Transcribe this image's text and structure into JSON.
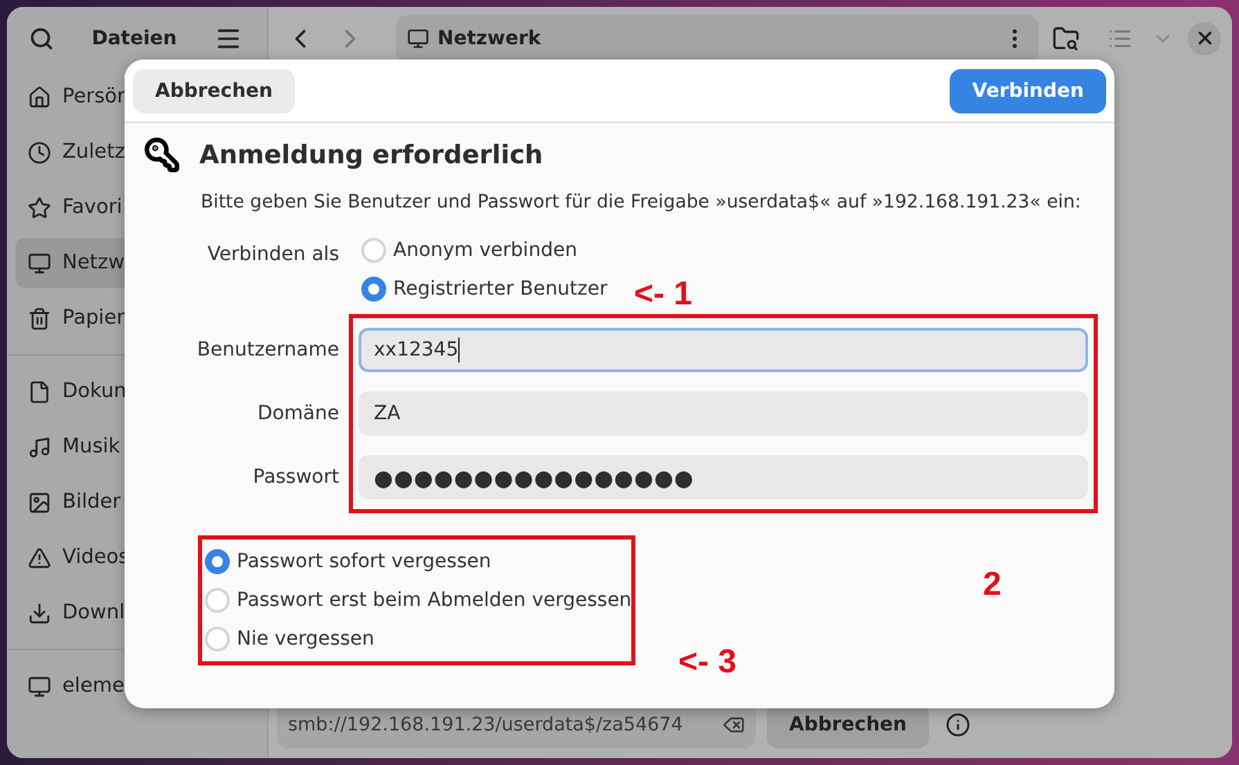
{
  "window": {
    "sidebar_title": "Dateien",
    "sidebar_groups": [
      [
        {
          "label": "Persön",
          "selected": false
        },
        {
          "label": "Zuletz",
          "selected": false
        },
        {
          "label": "Favori",
          "selected": false
        },
        {
          "label": "Netzw",
          "selected": true
        },
        {
          "label": "Papier",
          "selected": false
        }
      ],
      [
        {
          "label": "Dokun",
          "selected": false
        },
        {
          "label": "Musik",
          "selected": false
        },
        {
          "label": "Bilder",
          "selected": false
        },
        {
          "label": "Videos",
          "selected": false
        },
        {
          "label": "Downl",
          "selected": false
        }
      ],
      [
        {
          "label": "eleme",
          "selected": false
        }
      ]
    ],
    "path": "Netzwerk",
    "location_field": {
      "value": "smb://192.168.191.23/userdata$/za54674"
    },
    "location_cancel": "Abbrechen"
  },
  "dialog": {
    "cancel": "Abbrechen",
    "confirm": "Verbinden",
    "title": "Anmeldung erforderlich",
    "description": "Bitte geben Sie Benutzer und Passwort für die Freigabe »userdata$« auf »192.168.191.23« ein:",
    "connect_as": {
      "label": "Verbinden als",
      "options": [
        {
          "label": "Anonym verbinden",
          "selected": false
        },
        {
          "label": "Registrierter Benutzer",
          "selected": true
        }
      ]
    },
    "fields": [
      {
        "label": "Benutzername",
        "value": "xx12345",
        "focused": true
      },
      {
        "label": "Domäne",
        "value": "ZA",
        "focused": false
      },
      {
        "label": "Passwort",
        "value": "●●●●●●●●●●●●●●●●",
        "focused": false
      }
    ],
    "remember": [
      {
        "label": "Passwort sofort vergessen",
        "selected": true
      },
      {
        "label": "Passwort erst beim Abmelden vergessen",
        "selected": false
      },
      {
        "label": "Nie vergessen",
        "selected": false
      }
    ]
  },
  "annotations": [
    {
      "text": "<- 1"
    },
    {
      "text": "2"
    },
    {
      "text": "<- 3"
    }
  ]
}
